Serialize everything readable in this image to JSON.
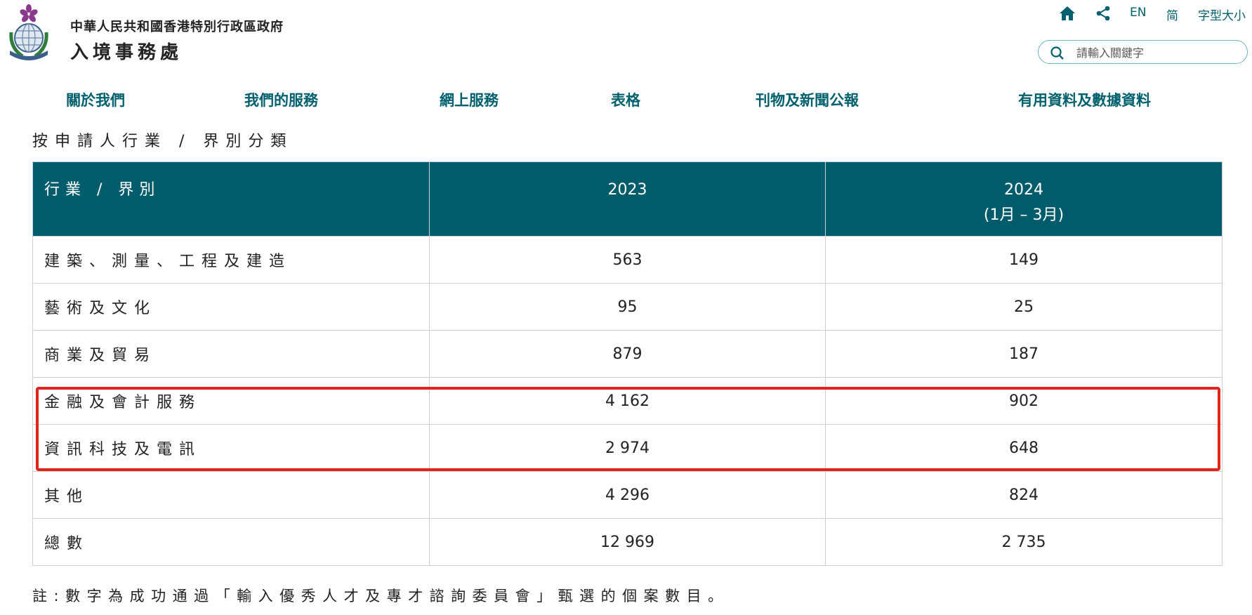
{
  "header": {
    "gov_name": "中華人民共和國香港特別行政區政府",
    "dept_name": "入境事務處",
    "links": {
      "en": "EN",
      "sc": "简",
      "font_size": "字型大小"
    },
    "icons": [
      "home-icon",
      "share-icon",
      "search-icon"
    ],
    "search_placeholder": "請輸入關鍵字"
  },
  "nav": [
    "關於我們",
    "我們的服務",
    "網上服務",
    "表格",
    "刊物及新聞公報",
    "有用資料及數據資料"
  ],
  "section_title": "按申請人行業 / 界別分類",
  "table": {
    "headers": {
      "industry": "行業 / 界別",
      "y2023": "2023",
      "y2024": "2024",
      "y2024_sub": "(1月 – 3月)"
    },
    "rows": [
      {
        "industry": "建築、測量、工程及建造",
        "y2023": "563",
        "y2024": "149"
      },
      {
        "industry": "藝術及文化",
        "y2023": "95",
        "y2024": "25"
      },
      {
        "industry": "商業及貿易",
        "y2023": "879",
        "y2024": "187"
      },
      {
        "industry": "金融及會計服務",
        "y2023": "4 162",
        "y2024": "902"
      },
      {
        "industry": "資訊科技及電訊",
        "y2023": "2 974",
        "y2024": "648"
      },
      {
        "industry": "其他",
        "y2023": "4 296",
        "y2024": "824"
      },
      {
        "industry": "總數",
        "y2023": "12 969",
        "y2024": "2 735"
      }
    ]
  },
  "note": "註:數字為成功通過「輸入優秀人才及專才諮詢委員會」甄選的個案數目。",
  "colors": {
    "accent": "#00606e",
    "header_bg": "#005b6b",
    "highlight": "#e3241c",
    "logo_purple": "#8a3a8c"
  }
}
